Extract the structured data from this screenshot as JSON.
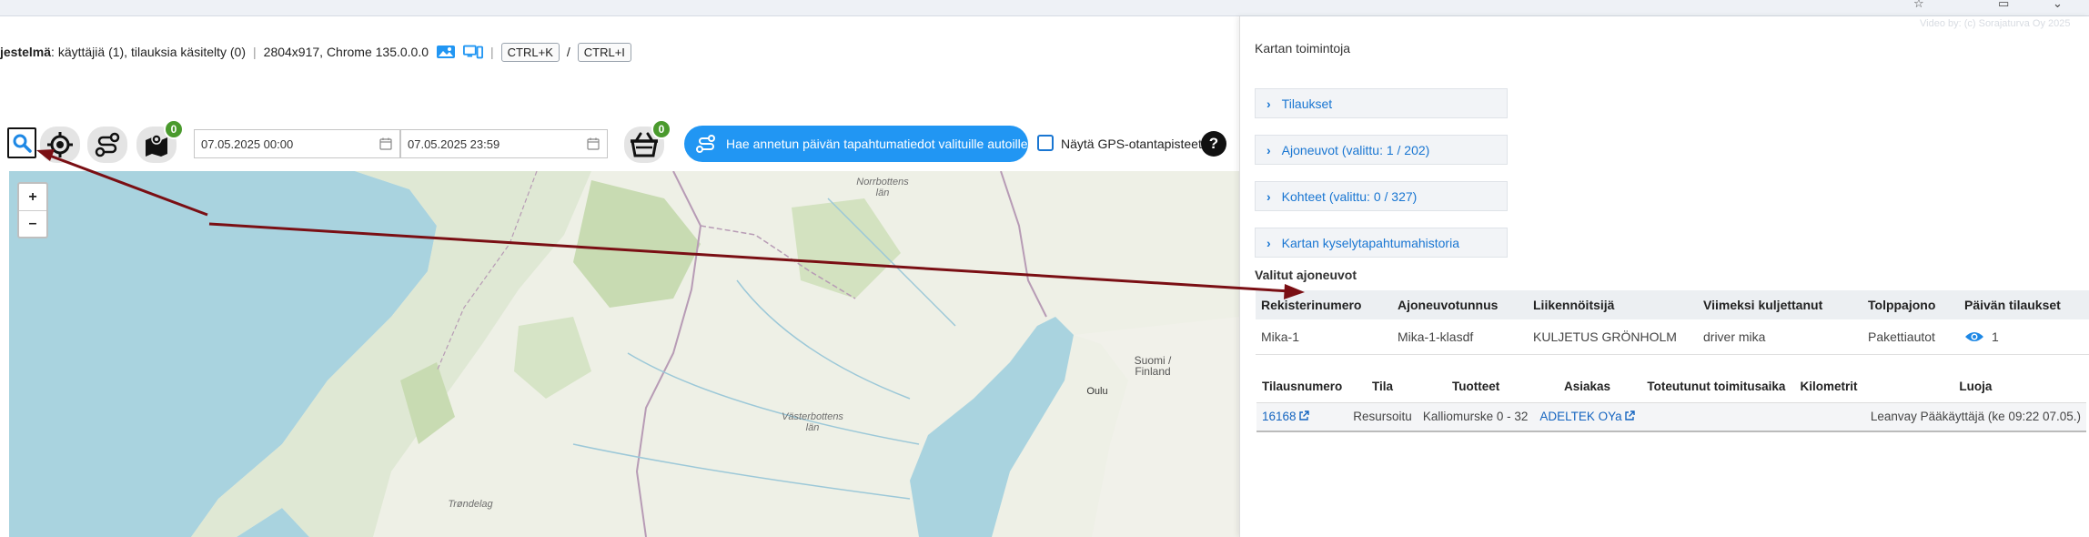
{
  "status": {
    "system_label": "jestelmä",
    "system_info": ": käyttäjiä (1), tilauksia käsitelty (0)",
    "resolution": "2804x917, Chrome 135.0.0.0",
    "shortcut_1": "CTRL+K",
    "slash": "/",
    "shortcut_2": "CTRL+I"
  },
  "toolbar": {
    "layers_badge": "0",
    "basket_badge": "0",
    "start_date": "07.05.2025 00:00",
    "end_date": "07.05.2025 23:59",
    "fetch_button": "Hae annetun päivän tapahtumatiedot valituille autoille",
    "gps_label": "Näytä GPS-otantapisteet",
    "help": "?"
  },
  "map": {
    "zoom_in": "+",
    "zoom_out": "–",
    "labels": {
      "norrbotten": "Norrbottens\nlän",
      "suomi": "Suomi /\nFinland",
      "oulu": "Oulu",
      "vasterbotten": "Västerbottens\nlän",
      "trondelag": "Trøndelag"
    }
  },
  "panel": {
    "title": "Kartan toimintoja",
    "accordions": [
      "Tilaukset",
      "Ajoneuvot (valittu: 1 / 202)",
      "Kohteet (valittu: 0 / 327)",
      "Kartan kyselytapahtumahistoria"
    ],
    "selected_title": "Valitut ajoneuvot",
    "vehicle_headers": [
      "Rekisterinumero",
      "Ajoneuvotunnus",
      "Liikennöitsijä",
      "Viimeksi kuljettanut",
      "Tolppajono",
      "Päivän tilaukset"
    ],
    "vehicle_row": {
      "reg": "Mika-1",
      "vid": "Mika-1-klasdf",
      "operator": "KULJETUS GRÖNHOLM",
      "driver": "driver mika",
      "queue": "Pakettiautot",
      "orders": "1"
    },
    "order_headers": [
      "Tilausnumero",
      "Tila",
      "Tuotteet",
      "Asiakas",
      "Toteutunut toimitusaika",
      "Kilometrit",
      "Luoja"
    ],
    "order_row": {
      "number": "16168",
      "state": "Resursoitu",
      "products": "Kalliomurske 0 - 32",
      "customer": "ADELTEK OYa",
      "delivery": "",
      "km": "",
      "creator": "Leanvay Pääkäyttäjä (ke 09:22 07.05.)"
    }
  },
  "watermark": "Video by: (c) Sorajaturva Oy 2025",
  "colors": {
    "accent": "#2196f3",
    "badge": "#4a9a2d",
    "arrow": "#7a0f14",
    "link": "#1565c0"
  }
}
